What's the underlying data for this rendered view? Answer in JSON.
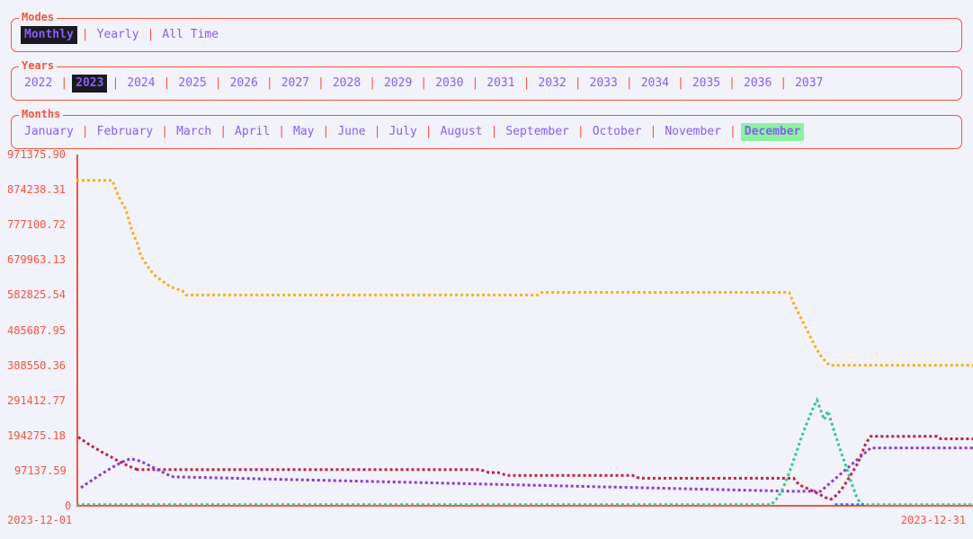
{
  "modes": {
    "legend": "Modes",
    "options": [
      {
        "label": "Monthly",
        "selected": true,
        "style": "dark"
      },
      {
        "label": "Yearly",
        "selected": false,
        "style": ""
      },
      {
        "label": "All Time",
        "selected": false,
        "style": ""
      }
    ]
  },
  "years": {
    "legend": "Years",
    "options": [
      {
        "label": "2022",
        "selected": false,
        "style": ""
      },
      {
        "label": "2023",
        "selected": true,
        "style": "dark"
      },
      {
        "label": "2024",
        "selected": false,
        "style": ""
      },
      {
        "label": "2025",
        "selected": false,
        "style": ""
      },
      {
        "label": "2026",
        "selected": false,
        "style": ""
      },
      {
        "label": "2027",
        "selected": false,
        "style": ""
      },
      {
        "label": "2028",
        "selected": false,
        "style": ""
      },
      {
        "label": "2029",
        "selected": false,
        "style": ""
      },
      {
        "label": "2030",
        "selected": false,
        "style": ""
      },
      {
        "label": "2031",
        "selected": false,
        "style": ""
      },
      {
        "label": "2032",
        "selected": false,
        "style": ""
      },
      {
        "label": "2033",
        "selected": false,
        "style": ""
      },
      {
        "label": "2034",
        "selected": false,
        "style": ""
      },
      {
        "label": "2035",
        "selected": false,
        "style": ""
      },
      {
        "label": "2036",
        "selected": false,
        "style": ""
      },
      {
        "label": "2037",
        "selected": false,
        "style": ""
      }
    ]
  },
  "months": {
    "legend": "Months",
    "options": [
      {
        "label": "January",
        "selected": false,
        "style": ""
      },
      {
        "label": "February",
        "selected": false,
        "style": ""
      },
      {
        "label": "March",
        "selected": false,
        "style": ""
      },
      {
        "label": "April",
        "selected": false,
        "style": ""
      },
      {
        "label": "May",
        "selected": false,
        "style": ""
      },
      {
        "label": "June",
        "selected": false,
        "style": ""
      },
      {
        "label": "July",
        "selected": false,
        "style": ""
      },
      {
        "label": "August",
        "selected": false,
        "style": ""
      },
      {
        "label": "September",
        "selected": false,
        "style": ""
      },
      {
        "label": "October",
        "selected": false,
        "style": ""
      },
      {
        "label": "November",
        "selected": false,
        "style": ""
      },
      {
        "label": "December",
        "selected": true,
        "style": "green"
      }
    ]
  },
  "colors": {
    "accent": "#f4553d",
    "option_text": "#8b5cf6",
    "selected_dark_bg": "#1a1a22",
    "selected_green_bg": "#8cf2a0",
    "background": "#f2f2fb"
  },
  "chart_data": {
    "type": "line",
    "title": "",
    "xlabel": "",
    "ylabel": "",
    "grid": false,
    "legend": "none",
    "x_axis_type": "date",
    "x_start": "2023-12-01",
    "x_end": "2023-12-31",
    "xticklabels": [
      "2023-12-01",
      "2023-12-31"
    ],
    "ylim": [
      0,
      971375.9
    ],
    "yticklabels": [
      "971375.90",
      "874238.31",
      "777100.72",
      "679963.13",
      "582825.54",
      "485687.95",
      "388550.36",
      "291412.77",
      "194275.18",
      "97137.59",
      "0"
    ],
    "ytickvalues": [
      971375.9,
      874238.31,
      777100.72,
      679963.13,
      582825.54,
      485687.95,
      388550.36,
      291412.77,
      194275.18,
      97137.59,
      0
    ],
    "series": [
      {
        "name": "series-gold",
        "color": "#ecb61f",
        "style": "dotted",
        "points": [
          [
            0.0,
            900000
          ],
          [
            0.04,
            900000
          ],
          [
            0.047,
            855000
          ],
          [
            0.055,
            820000
          ],
          [
            0.062,
            760000
          ],
          [
            0.068,
            725000
          ],
          [
            0.072,
            690000
          ],
          [
            0.08,
            660000
          ],
          [
            0.086,
            640000
          ],
          [
            0.094,
            625000
          ],
          [
            0.105,
            605000
          ],
          [
            0.118,
            595000
          ],
          [
            0.122,
            582825
          ],
          [
            0.515,
            582825
          ],
          [
            0.519,
            590000
          ],
          [
            0.795,
            590000
          ],
          [
            0.8,
            560000
          ],
          [
            0.806,
            530000
          ],
          [
            0.812,
            500000
          ],
          [
            0.818,
            470000
          ],
          [
            0.824,
            440000
          ],
          [
            0.83,
            415000
          ],
          [
            0.836,
            398000
          ],
          [
            0.84,
            388550
          ],
          [
            1.0,
            388550
          ]
        ]
      },
      {
        "name": "series-crimson",
        "color": "#bf2343",
        "style": "dotted",
        "points": [
          [
            0.002,
            190000
          ],
          [
            0.008,
            180000
          ],
          [
            0.015,
            168000
          ],
          [
            0.022,
            158000
          ],
          [
            0.03,
            146000
          ],
          [
            0.038,
            136000
          ],
          [
            0.045,
            126000
          ],
          [
            0.052,
            117000
          ],
          [
            0.06,
            108000
          ],
          [
            0.068,
            100000
          ],
          [
            0.066,
            100000
          ],
          [
            0.45,
            100000
          ],
          [
            0.46,
            92000
          ],
          [
            0.47,
            92000
          ],
          [
            0.48,
            84000
          ],
          [
            0.62,
            84000
          ],
          [
            0.628,
            76000
          ],
          [
            0.8,
            76000
          ],
          [
            0.806,
            58000
          ],
          [
            0.815,
            48000
          ],
          [
            0.822,
            40000
          ],
          [
            0.83,
            30000
          ],
          [
            0.836,
            22000
          ],
          [
            0.842,
            18000
          ],
          [
            0.848,
            30000
          ],
          [
            0.854,
            48000
          ],
          [
            0.86,
            70000
          ],
          [
            0.866,
            95000
          ],
          [
            0.872,
            120000
          ],
          [
            0.876,
            145000
          ],
          [
            0.88,
            170000
          ],
          [
            0.884,
            185000
          ],
          [
            0.886,
            192000
          ],
          [
            0.96,
            192000
          ],
          [
            0.964,
            185000
          ],
          [
            1.0,
            185000
          ]
        ]
      },
      {
        "name": "series-purple",
        "color": "#8b3ccc",
        "style": "dotted",
        "points": [
          [
            0.005,
            50000
          ],
          [
            0.012,
            62000
          ],
          [
            0.02,
            75000
          ],
          [
            0.028,
            88000
          ],
          [
            0.036,
            100000
          ],
          [
            0.044,
            112000
          ],
          [
            0.052,
            122000
          ],
          [
            0.06,
            130000
          ],
          [
            0.068,
            126000
          ],
          [
            0.076,
            118000
          ],
          [
            0.084,
            108000
          ],
          [
            0.092,
            98000
          ],
          [
            0.1,
            88000
          ],
          [
            0.108,
            80000
          ],
          [
            0.8,
            40000
          ],
          [
            0.83,
            40000
          ],
          [
            0.886,
            160000
          ],
          [
            1.0,
            160000
          ]
        ]
      },
      {
        "name": "series-teal",
        "color": "#36c98e",
        "style": "dotted",
        "points": [
          [
            0.0,
            3000
          ],
          [
            0.775,
            3000
          ],
          [
            0.782,
            22000
          ],
          [
            0.788,
            48000
          ],
          [
            0.793,
            78000
          ],
          [
            0.798,
            112000
          ],
          [
            0.803,
            148000
          ],
          [
            0.808,
            185000
          ],
          [
            0.813,
            218000
          ],
          [
            0.818,
            248000
          ],
          [
            0.823,
            278000
          ],
          [
            0.826,
            292000
          ],
          [
            0.83,
            265000
          ],
          [
            0.834,
            238000
          ],
          [
            0.838,
            262000
          ],
          [
            0.842,
            232000
          ],
          [
            0.846,
            200000
          ],
          [
            0.85,
            170000
          ],
          [
            0.854,
            140000
          ],
          [
            0.858,
            112000
          ],
          [
            0.862,
            82000
          ],
          [
            0.866,
            52000
          ],
          [
            0.87,
            26000
          ],
          [
            0.874,
            8000
          ],
          [
            0.878,
            3000
          ],
          [
            1.0,
            3000
          ]
        ]
      },
      {
        "name": "series-blue",
        "color": "#2f6fd8",
        "style": "dotted",
        "points": [
          [
            0.846,
            3000
          ],
          [
            0.878,
            3000
          ]
        ]
      }
    ]
  }
}
